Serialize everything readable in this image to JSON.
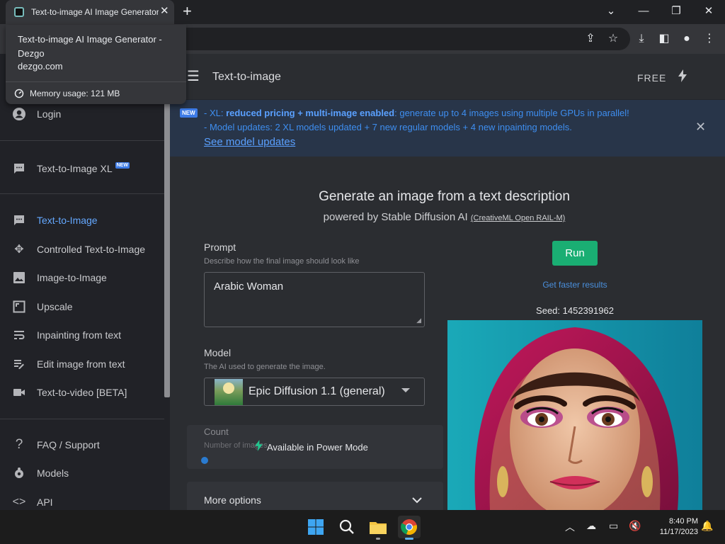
{
  "browser": {
    "tab_title": "Text-to-image AI Image Generator - Dezgo",
    "tooltip": {
      "title": "Text-to-image AI Image Generator - Dezgo",
      "domain": "dezgo.com",
      "memory": "Memory usage: 121 MB"
    }
  },
  "appbar": {
    "title": "Text-to-image",
    "plan": "FREE"
  },
  "sidebar": {
    "top_items": [
      {
        "label": "Login",
        "icon": "account-icon"
      }
    ],
    "xl_item": {
      "label": "Text-to-Image XL",
      "badge": "NEW",
      "icon": "chat-icon"
    },
    "items": [
      {
        "label": "Text-to-Image",
        "icon": "chat-icon",
        "active": true
      },
      {
        "label": "Controlled Text-to-Image",
        "icon": "move-icon",
        "active": false
      },
      {
        "label": "Image-to-Image",
        "icon": "image-icon",
        "active": false
      },
      {
        "label": "Upscale",
        "icon": "expand-icon",
        "active": false
      },
      {
        "label": "Inpainting from text",
        "icon": "wrap-text-icon",
        "active": false
      },
      {
        "label": "Edit image from text",
        "icon": "edit-text-icon",
        "active": false
      },
      {
        "label": "Text-to-video [BETA]",
        "icon": "video-icon",
        "active": false
      }
    ],
    "bottom_items": [
      {
        "label": "FAQ / Support",
        "icon": "help-icon"
      },
      {
        "label": "Models",
        "icon": "models-icon"
      },
      {
        "label": "API",
        "icon": "code-icon"
      }
    ]
  },
  "banner": {
    "badge": "NEW",
    "line1_prefix": "- XL: ",
    "line1_bold": "reduced pricing + multi-image enabled",
    "line1_rest": ": generate up to 4 images using multiple GPUs in parallel!",
    "line2": "- Model updates: 2 XL models updated + 7 new regular models + 4 new inpainting models.",
    "link": "See model updates"
  },
  "main": {
    "heading": "Generate an image from a text description",
    "subheading": "powered by Stable Diffusion AI",
    "license": "(CreativeML Open RAIL-M)",
    "prompt": {
      "label": "Prompt",
      "hint": "Describe how the final image should look like",
      "value": "Arabic Woman"
    },
    "model": {
      "label": "Model",
      "hint": "The AI used to generate the image.",
      "value": "Epic Diffusion 1.1 (general)"
    },
    "count": {
      "label": "Count",
      "hint": "Number of images",
      "overlay": "Available in Power Mode"
    },
    "more_options": "More options",
    "run": "Run",
    "faster": "Get faster results",
    "seed": "Seed: 1452391962"
  },
  "taskbar": {
    "time": "8:40 PM",
    "date": "11/17/2023"
  }
}
